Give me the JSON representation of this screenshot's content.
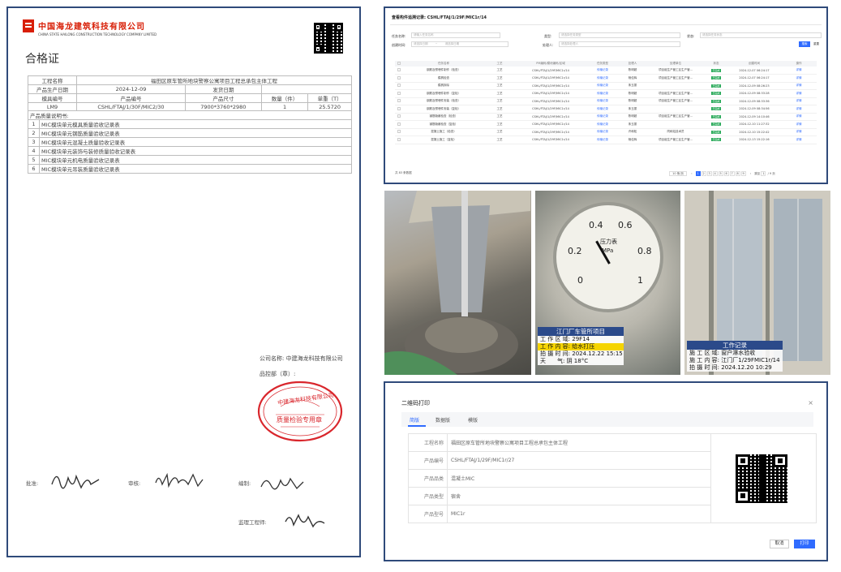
{
  "certificate": {
    "company_cn": "中国海龙建筑科技有限公司",
    "company_en": "CHINA STATE HAILONG CONSTRUCTION TECHNOLOGY COMPANY LIMITED",
    "title": "合格证",
    "labels": {
      "project_name": "工程名称",
      "production_date": "产品生产日期",
      "ship_date": "发货日期",
      "mold_no": "模具编号",
      "product_no": "产品编号",
      "product_size": "产品尺寸",
      "quantity": "数量（件）",
      "weight": "单重（T）",
      "quality_records": "产品质量说明书:"
    },
    "values": {
      "project_name": "福田区原车管所地块警察公寓项目工程总承包主体工程",
      "production_date": "2024-12-09",
      "ship_date": "",
      "mold_no": "LM9",
      "product_no": "CSHL/FTAJ/1/30F/MIC2/30",
      "product_size": "7900*3760*2980",
      "quantity": "1",
      "weight": "25.5720"
    },
    "records": [
      {
        "no": "1",
        "text": "MIC模块单元模具质量验收记录表"
      },
      {
        "no": "2",
        "text": "MIC模块单元钢筋质量验收记录表"
      },
      {
        "no": "3",
        "text": "MIC模块单元混凝土质量验收记录表"
      },
      {
        "no": "4",
        "text": "MIC模块单元装饰与装修质量验收记录表"
      },
      {
        "no": "5",
        "text": "MIC模块单元机电质量验收记录表"
      },
      {
        "no": "6",
        "text": "MIC模块单元吊装质量验收记录表"
      }
    ],
    "company_label": "公司名称: 中建海龙科技有限公司",
    "qc_label": "品控部（章）:",
    "stamp_text": "中建海龙科技有限公司",
    "stamp_sub": "质量检验专用章",
    "sig_labels": {
      "approve": "批准:",
      "review": "审核:",
      "prepare": "编制:",
      "supervisor": "监理工程师:"
    }
  },
  "list_window": {
    "title": "查看构件追溯记录: CSHL/FTAJ/1/29F/MIC1r/14",
    "filters": {
      "task_name_label": "任务名称:",
      "task_name_placeholder": "请输入任务名称",
      "type_label": "类型:",
      "type_placeholder": "请选择任务类型",
      "status_label": "状态:",
      "status_placeholder": "请选择任务状态",
      "created_label": "创建时间:",
      "date_start": "请选择日期",
      "date_sep": "~",
      "date_end": "请选择日期",
      "handler_label": "处理人:",
      "handler_placeholder": "请选择处理人",
      "search": "搜索",
      "reset": "重置"
    },
    "columns": [
      "任务名称",
      "工艺",
      "PM编码/模块编码/区域",
      "任务类型",
      "处理人",
      "处理单位",
      "状态",
      "创建时间",
      "操作"
    ],
    "rows": [
      [
        "钢筋及预埋件制作（检查）",
        "工艺",
        "CSHL/FTAJ/1/29F/MIC1r/14",
        "传输记录",
        "陈明超",
        "项目组生产管工区生产管...",
        "已完成",
        "2024-12-07 06:24:17",
        "详情"
      ],
      [
        "模具检查",
        "工艺",
        "CSHL/FTAJ/1/29F/MIC1r/14",
        "传输记录",
        "杨佳辉",
        "项目组生产管工区生产管...",
        "已完成",
        "2024-12-07 06:24:17",
        "详情"
      ],
      [
        "模具拆除",
        "工艺",
        "CSHL/FTAJ/1/29F/MIC1r/14",
        "传输记录",
        "朱玉振",
        "",
        "已完成",
        "2024-12-09 08:26:23",
        "详情"
      ],
      [
        "钢筋及预埋件制作（复检）",
        "工艺",
        "CSHL/FTAJ/1/29F/MIC1r/14",
        "传输记录",
        "陈明超",
        "项目组生产管工区生产管...",
        "已完成",
        "2024-12-09 08:33:28",
        "详情"
      ],
      [
        "钢筋及预埋件安装（检查）",
        "工艺",
        "CSHL/FTAJ/1/29F/MIC1r/14",
        "传输记录",
        "陈明超",
        "项目组生产管工区生产管...",
        "已完成",
        "2024-12-09 08:33:36",
        "详情"
      ],
      [
        "钢筋及预埋件安装（复检）",
        "工艺",
        "CSHL/FTAJ/1/29F/MIC1r/14",
        "传输记录",
        "朱玉振",
        "",
        "已完成",
        "2024-12-09 08:34:56",
        "详情"
      ],
      [
        "钢筋隐蔽检查（检查）",
        "工艺",
        "CSHL/FTAJ/1/29F/MIC1r/14",
        "传输记录",
        "陈明超",
        "项目组生产管工区生产管...",
        "已完成",
        "2024-12-09 14:10:46",
        "详情"
      ],
      [
        "钢筋隐蔽检查（复检）",
        "工艺",
        "CSHL/FTAJ/1/29F/MIC1r/14",
        "传输记录",
        "朱玉振",
        "",
        "已完成",
        "2024-12-10 11:27:32",
        "详情"
      ],
      [
        "混凝土施工（检查）",
        "工艺",
        "CSHL/FTAJ/1/29F/MIC1r/14",
        "传输记录",
        "许和松",
        "同和站技术员",
        "已完成",
        "2024-12-10 15:22:42",
        "详情"
      ],
      [
        "混凝土施工（复检）",
        "工艺",
        "CSHL/FTAJ/1/29F/MIC1r/14",
        "传输记录",
        "杨佳辉",
        "项目组生产管工区生产管...",
        "已完成",
        "2024-12-13 15:22:16",
        "详情"
      ]
    ],
    "total": "共 83 条数据",
    "page_size": "10 条/页",
    "pages": [
      "1",
      "2",
      "3",
      "4",
      "5",
      "6",
      "7",
      "8",
      "9"
    ],
    "goto_label": "跳至",
    "goto_value": "1",
    "page_suffix": "/ 9 页"
  },
  "photos": {
    "gauge": {
      "numbers": [
        "0.4",
        "0.6",
        "0.2",
        "0.8",
        "0",
        "1"
      ],
      "title": "压力表",
      "unit": "MPa",
      "wm_header": "江门厂车管所项目",
      "wm_lines": [
        "工 作 区 域: 29F14",
        "工 作 内 容: 给水打压",
        "拍 摄 时 间: 2024.12.22 15:15",
        "天　　气: 阴 18°C"
      ]
    },
    "window": {
      "wm_header": "工作记录",
      "wm_lines": [
        "施 工 区 域: 窗户淋水验收",
        "施 工 内 容: 江门厂1/29FMIC1r/14",
        "拍 摄 时 间: 2024.12.20 10:29"
      ]
    }
  },
  "qr_dialog": {
    "title": "二维码打印",
    "tabs": [
      "简版",
      "数据版",
      "模版"
    ],
    "fields": [
      {
        "label": "工程名称",
        "value": "福田区原车管所地块警察公寓项目工程总承包主体工程"
      },
      {
        "label": "产品编号",
        "value": "CSHL/FTAJ/1/29F/MIC1r/27"
      },
      {
        "label": "产品品类",
        "value": "混凝土MIC"
      },
      {
        "label": "产品类型",
        "value": "宿舍"
      },
      {
        "label": "产品型号",
        "value": "MIC1r"
      }
    ],
    "cancel": "取消",
    "print": "打印"
  }
}
